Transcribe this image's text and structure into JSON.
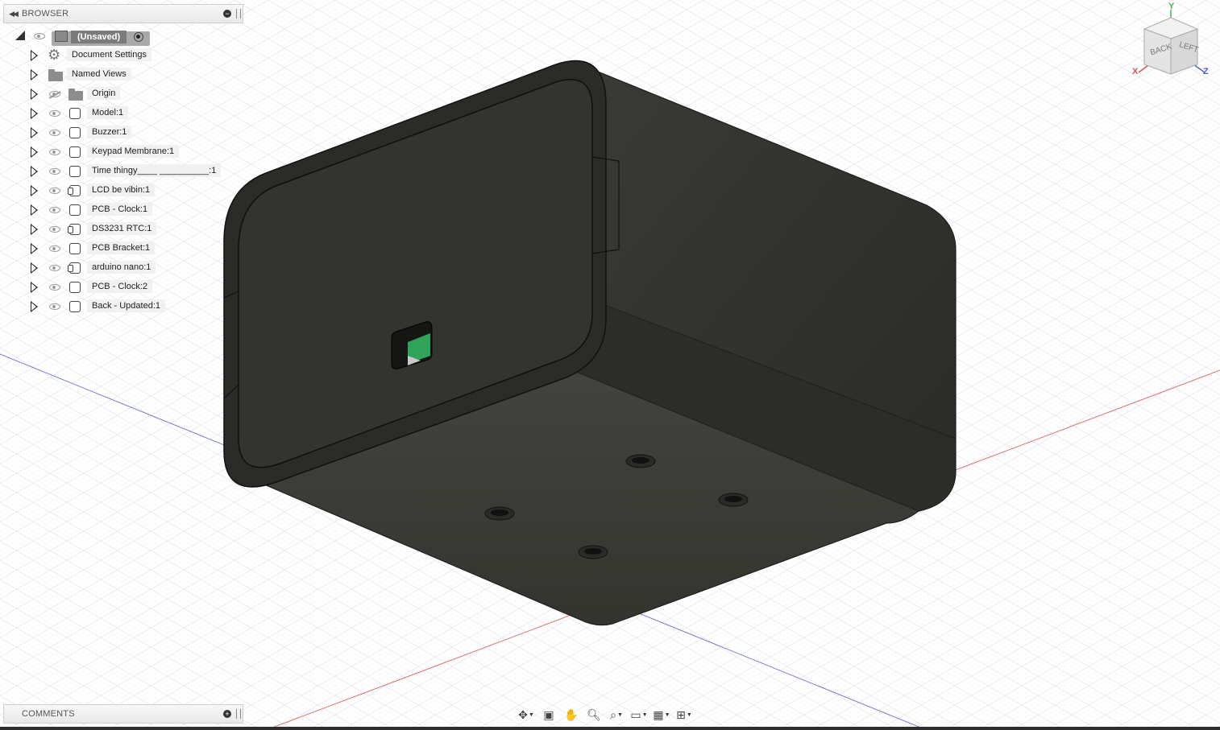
{
  "browser": {
    "title": "BROWSER",
    "root": {
      "label": "(Unsaved)"
    },
    "items": [
      {
        "label": "Document Settings",
        "icon": "gear-icon",
        "eye": false
      },
      {
        "label": "Named Views",
        "icon": "folder-icon",
        "eye": false
      },
      {
        "label": "Origin",
        "icon": "folder-icon",
        "eye": "hidden"
      },
      {
        "label": "Model:1",
        "icon": "component-icon",
        "eye": true
      },
      {
        "label": "Buzzer:1",
        "icon": "component-icon",
        "eye": true
      },
      {
        "label": "Keypad Membrane:1",
        "icon": "component-icon",
        "eye": true
      },
      {
        "label": "Time thingy____ __________:1",
        "icon": "component-icon",
        "eye": true
      },
      {
        "label": "LCD be vibin:1",
        "icon": "linked-component-icon",
        "eye": true
      },
      {
        "label": "PCB - Clock:1",
        "icon": "component-icon",
        "eye": true
      },
      {
        "label": "DS3231 RTC:1",
        "icon": "linked-component-icon",
        "eye": true
      },
      {
        "label": "PCB Bracket:1",
        "icon": "component-icon",
        "eye": true
      },
      {
        "label": "arduino nano:1",
        "icon": "linked-component-icon",
        "eye": true
      },
      {
        "label": "PCB - Clock:2",
        "icon": "component-icon",
        "eye": true
      },
      {
        "label": "Back - Updated:1",
        "icon": "component-icon",
        "eye": true
      }
    ]
  },
  "comments": {
    "title": "COMMENTS"
  },
  "viewcube": {
    "face_back": "BACK",
    "face_left": "LEFT",
    "axis_x": "X",
    "axis_y": "Y",
    "axis_z": "Z"
  },
  "navbar": {
    "buttons": [
      "orbit-icon",
      "look-at-icon",
      "pan-icon",
      "zoom-icon",
      "fit-icon",
      "display-settings-icon",
      "grid-settings-icon",
      "viewports-icon"
    ]
  },
  "colors": {
    "model_body": "#2f2f2c",
    "model_face": "#3b3b37",
    "grid_line": "#d8dde3",
    "axis_red": "#e06060",
    "axis_blue": "#6b6bd8",
    "accent_green": "#2fa35a"
  }
}
